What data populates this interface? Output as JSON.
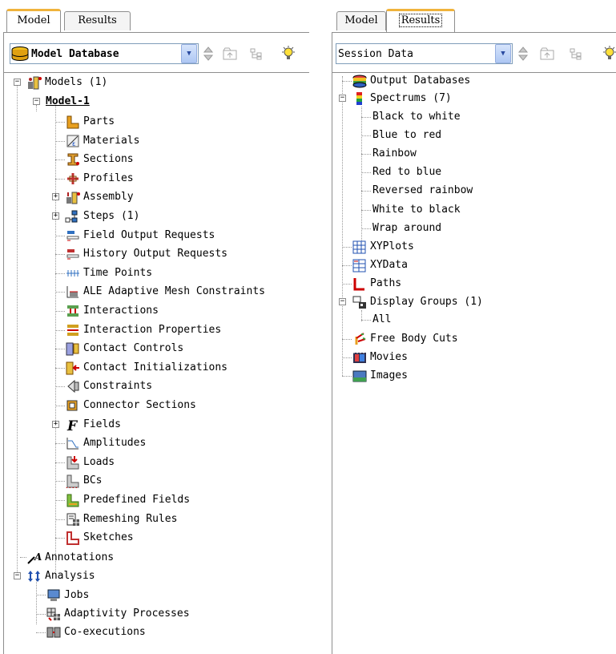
{
  "left": {
    "tabs": [
      "Model",
      "Results"
    ],
    "database_select": "Model Database",
    "tree": {
      "root": "Models (1)",
      "model": "Model-1",
      "items": [
        "Parts",
        "Materials",
        "Sections",
        "Profiles",
        "Assembly",
        "Steps (1)",
        "Field Output Requests",
        "History Output Requests",
        "Time Points",
        "ALE Adaptive Mesh Constraints",
        "Interactions",
        "Interaction Properties",
        "Contact Controls",
        "Contact Initializations",
        "Constraints",
        "Connector Sections",
        "Fields",
        "Amplitudes",
        "Loads",
        "BCs",
        "Predefined Fields",
        "Remeshing Rules",
        "Sketches"
      ],
      "annotations": "Annotations",
      "analysis": "Analysis",
      "analysis_items": [
        "Jobs",
        "Adaptivity Processes",
        "Co-executions"
      ]
    }
  },
  "right": {
    "tabs": [
      "Model",
      "Results"
    ],
    "session_select": "Session Data",
    "tree": {
      "output_databases": "Output Databases",
      "spectrums": "Spectrums (7)",
      "spectrum_items": [
        "Black to white",
        "Blue to red",
        "Rainbow",
        "Red to blue",
        "Reversed rainbow",
        "White to black",
        "Wrap around"
      ],
      "xyplots": "XYPlots",
      "xydata": "XYData",
      "paths": "Paths",
      "display_groups": "Display Groups (1)",
      "display_group_items": [
        "All"
      ],
      "free_body_cuts": "Free Body Cuts",
      "movies": "Movies",
      "images": "Images"
    }
  },
  "colors": {
    "tab_accent": "#f0b33c",
    "border": "#8e8e8e"
  }
}
